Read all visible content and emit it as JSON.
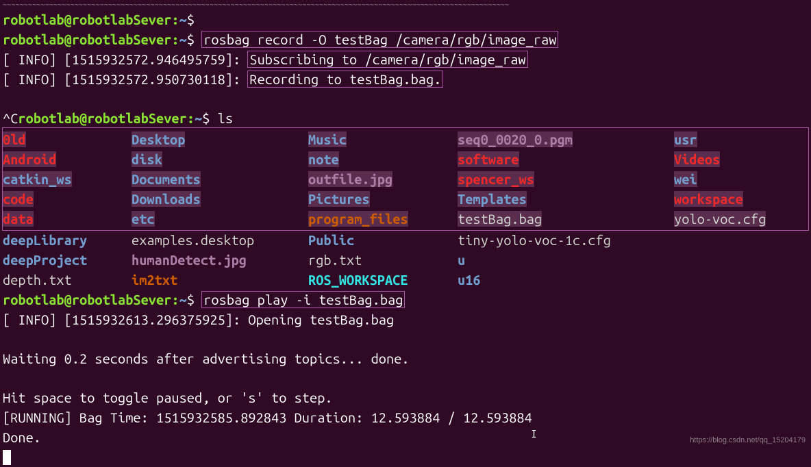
{
  "prompt": {
    "user": "robotlab",
    "host": "robotlabSever",
    "cwd": "~",
    "sep": "@",
    "colon": ":",
    "sigil": "$"
  },
  "line_top_trunc": "~~~~~~~~~~~~~~~~~~~~~~~~~~~~~~~~~~~~~~~~~~~~~~~~~~~~~~~~~~~~~~~~~~~~~~~~~~~~~~~~~~~~~~~~~~~~~~~~~~~~~~~~~~~~~~~~~~~~~~~~",
  "cmd1": "rosbag record -O testBag /camera/rgb/image_raw",
  "info1": {
    "prefix": "[ INFO] [1515932572.946495759]: ",
    "msg": "Subscribing to /camera/rgb/image_raw"
  },
  "info2": {
    "prefix": "[ INFO] [1515932572.950730118]: ",
    "msg": "Recording to testBag.bag."
  },
  "interrupt_prefix": "^C",
  "cmd2": "ls",
  "ls_block1": [
    [
      "0ld",
      "Desktop",
      "Music",
      "seq0_0020_0.pgm",
      "usr"
    ],
    [
      "Android",
      "disk",
      "note",
      "software",
      "Videos"
    ],
    [
      "catkin_ws",
      "Documents",
      "outfile.jpg",
      "spencer_ws",
      "wei"
    ],
    [
      "code",
      "Downloads",
      "Pictures",
      "Templates",
      "workspace"
    ],
    [
      "data",
      "etc",
      "program_files",
      "testBag.bag",
      "yolo-voc.cfg"
    ]
  ],
  "ls_block1_classes": [
    [
      "dir-red sel",
      "dir-blue sel",
      "dir-blue sel",
      "file-purple sel",
      "dir-blue sel"
    ],
    [
      "dir-red sel",
      "dir-blue sel",
      "dir-blue sel",
      "dir-red sel",
      "dir-red sel"
    ],
    [
      "dir-blue sel",
      "dir-blue sel",
      "file-purple sel",
      "dir-red sel",
      "dir-blue sel"
    ],
    [
      "dir-red sel",
      "dir-blue sel",
      "dir-blue sel",
      "dir-blue sel",
      "dir-red sel"
    ],
    [
      "dir-red sel",
      "dir-blue sel",
      "dir-orange sel",
      "file-white sel",
      "file-white sel"
    ]
  ],
  "ls_block2": [
    [
      "deepLibrary",
      "examples.desktop",
      "Public",
      "tiny-yolo-voc-1c.cfg",
      ""
    ],
    [
      "deepProject",
      "humanDetect.jpg",
      "rgb.txt",
      "u",
      ""
    ],
    [
      "depth.txt",
      "im2txt",
      "ROS_WORKSPACE",
      "u16",
      ""
    ]
  ],
  "ls_block2_classes": [
    [
      "dir-blue",
      "file-white",
      "dir-blue",
      "file-white",
      ""
    ],
    [
      "dir-blue",
      "file-purple",
      "file-white",
      "dir-blue",
      ""
    ],
    [
      "file-white",
      "sym-orange",
      "file-teal",
      "dir-blue",
      ""
    ]
  ],
  "cmd3": "rosbag play -i testBag.bag",
  "info3": "[ INFO] [1515932613.296375925]: Opening testBag.bag",
  "wait_line": "Waiting 0.2 seconds after advertising topics... done.",
  "hit_line": "Hit space to toggle paused, or 's' to step.",
  "run_line": " [RUNNING]  Bag Time: 1515932585.892843   Duration: 12.593884 / 12.593884",
  "done_line": "Done.",
  "watermark": "https://blog.csdn.net/qq_15204179"
}
